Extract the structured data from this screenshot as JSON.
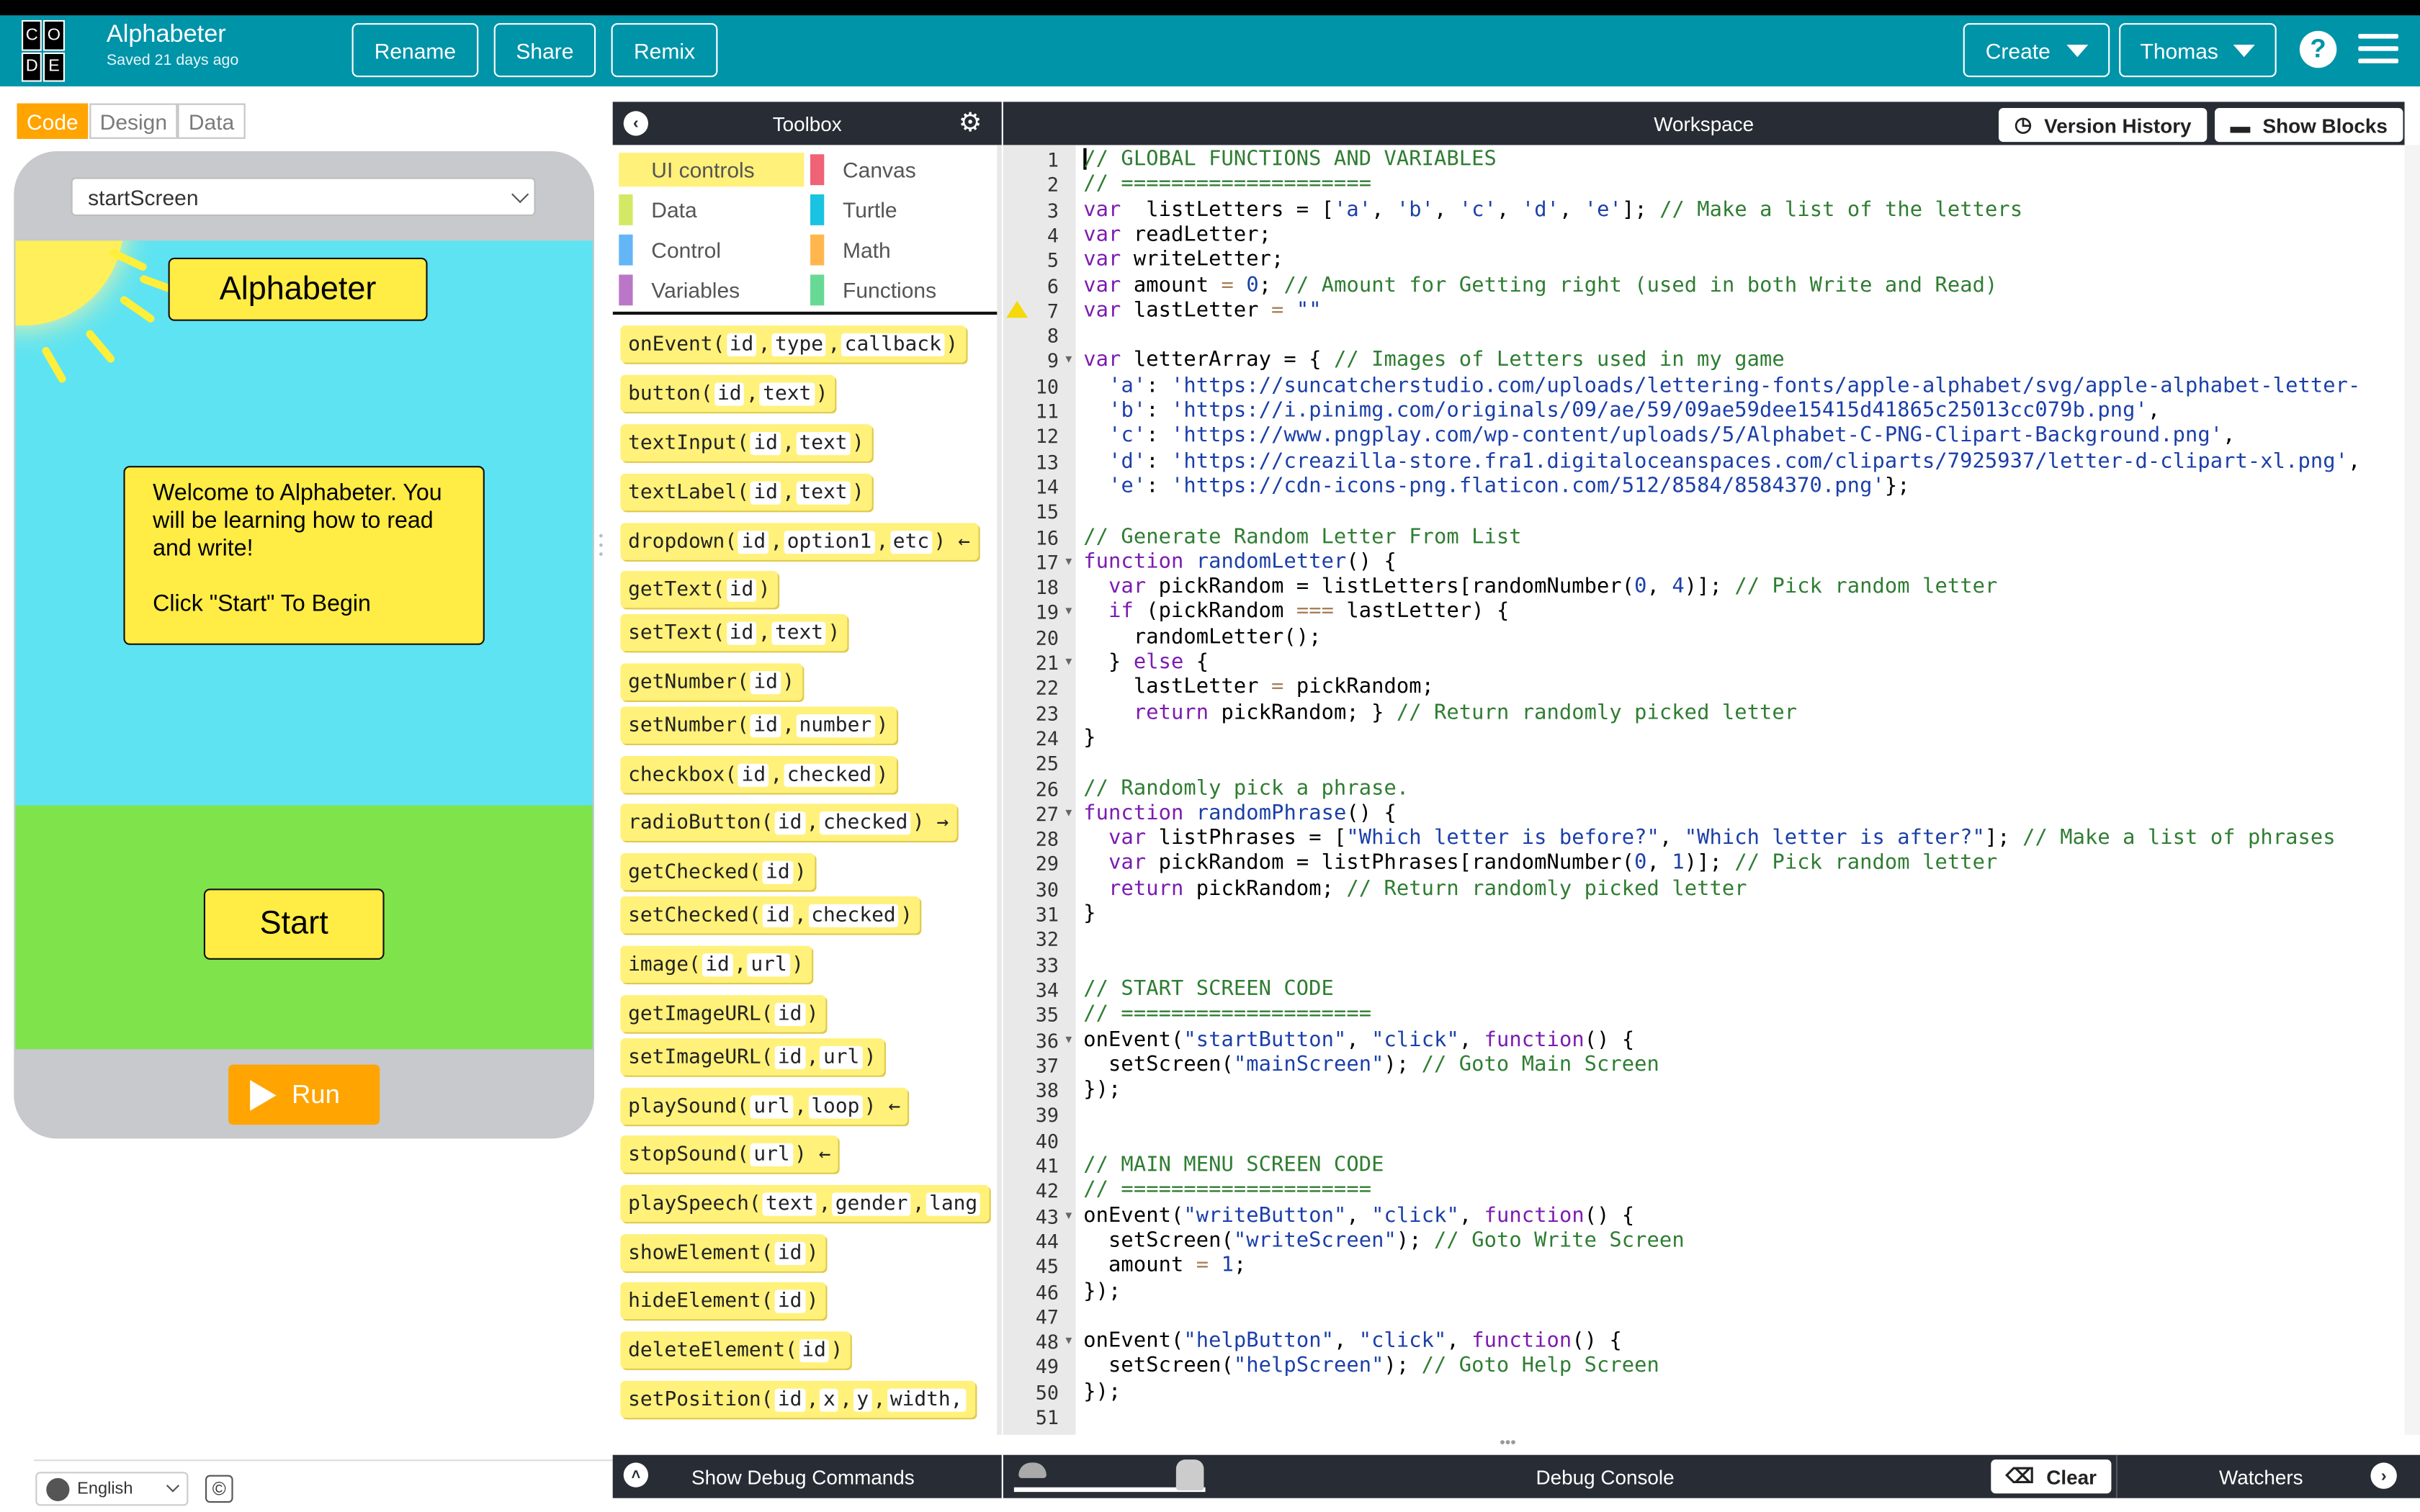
{
  "app": {
    "name": "Alphabeter",
    "saved": "Saved 21 days ago",
    "logo_letters": [
      "C",
      "O",
      "",
      "D",
      "E",
      ""
    ]
  },
  "header": {
    "rename": "Rename",
    "share": "Share",
    "remix": "Remix",
    "create": "Create",
    "user": "Thomas",
    "help": "?"
  },
  "left_tabs": {
    "code": "Code",
    "design": "Design",
    "data": "Data"
  },
  "preview": {
    "screen_select": "startScreen",
    "title": "Alphabeter",
    "welcome_line1": "Welcome to Alphabeter. You will be learning how to read and write!",
    "welcome_line2": "Click \"Start\" To Begin",
    "start": "Start",
    "run": "Run"
  },
  "footer": {
    "language": "English",
    "copyright": "©"
  },
  "toolbox": {
    "title": "Toolbox",
    "categories": [
      {
        "label": "UI controls",
        "color": "#fff17a"
      },
      {
        "label": "Canvas",
        "color": "#f06276"
      },
      {
        "label": "Data",
        "color": "#d3e965"
      },
      {
        "label": "Turtle",
        "color": "#19c3e1"
      },
      {
        "label": "Control",
        "color": "#64b5f6"
      },
      {
        "label": "Math",
        "color": "#ffb74d"
      },
      {
        "label": "Variables",
        "color": "#bb77c7"
      },
      {
        "label": "Functions",
        "color": "#68d995"
      }
    ],
    "blocks": [
      {
        "name": "onEvent",
        "params": [
          "id",
          "type",
          "callback"
        ],
        "tail": ")"
      },
      {
        "name": "button",
        "params": [
          "id",
          "text"
        ],
        "tail": ")"
      },
      {
        "name": "textInput",
        "params": [
          "id",
          "text"
        ],
        "tail": ")"
      },
      {
        "name": "textLabel",
        "params": [
          "id",
          "text"
        ],
        "tail": ")"
      },
      {
        "name": "dropdown",
        "params": [
          "id",
          "option1",
          "etc"
        ],
        "tail": ") ←"
      },
      {
        "name": "getText",
        "params": [
          "id"
        ],
        "tail": ")"
      },
      {
        "name": "setText",
        "params": [
          "id",
          "text"
        ],
        "tail": ")"
      },
      {
        "name": "getNumber",
        "params": [
          "id"
        ],
        "tail": ")"
      },
      {
        "name": "setNumber",
        "params": [
          "id",
          "number"
        ],
        "tail": ")"
      },
      {
        "name": "checkbox",
        "params": [
          "id",
          "checked"
        ],
        "tail": ")"
      },
      {
        "name": "radioButton",
        "params": [
          "id",
          "checked"
        ],
        "tail": ") →"
      },
      {
        "name": "getChecked",
        "params": [
          "id"
        ],
        "tail": ")"
      },
      {
        "name": "setChecked",
        "params": [
          "id",
          "checked"
        ],
        "tail": ")"
      },
      {
        "name": "image",
        "params": [
          "id",
          "url"
        ],
        "tail": ")"
      },
      {
        "name": "getImageURL",
        "params": [
          "id"
        ],
        "tail": ")"
      },
      {
        "name": "setImageURL",
        "params": [
          "id",
          "url"
        ],
        "tail": ")"
      },
      {
        "name": "playSound",
        "params": [
          "url",
          "loop"
        ],
        "tail": ") ←"
      },
      {
        "name": "stopSound",
        "params": [
          "url"
        ],
        "tail": ") ←"
      },
      {
        "name": "playSpeech",
        "params": [
          "text",
          "gender",
          "lang"
        ],
        "tail": ""
      },
      {
        "name": "showElement",
        "params": [
          "id"
        ],
        "tail": ")"
      },
      {
        "name": "hideElement",
        "params": [
          "id"
        ],
        "tail": ")"
      },
      {
        "name": "deleteElement",
        "params": [
          "id"
        ],
        "tail": ")"
      },
      {
        "name": "setPosition",
        "params": [
          "id",
          "x",
          "y",
          "width,"
        ],
        "tail": ""
      }
    ]
  },
  "workspace": {
    "title": "Workspace",
    "version_history": "Version History",
    "show_blocks": "Show Blocks",
    "fold_lines": [
      9,
      17,
      19,
      21,
      27,
      36,
      43,
      48
    ],
    "code": [
      [
        [
          "cm",
          "// GLOBAL FUNCTIONS AND VARIABLES"
        ]
      ],
      [
        [
          "cm",
          "// ===================="
        ]
      ],
      [
        [
          "kw",
          "var"
        ],
        [
          "",
          "  listLetters = ["
        ],
        [
          "st",
          "'a'"
        ],
        [
          "",
          ", "
        ],
        [
          "st",
          "'b'"
        ],
        [
          "",
          ", "
        ],
        [
          "st",
          "'c'"
        ],
        [
          "",
          ", "
        ],
        [
          "st",
          "'d'"
        ],
        [
          "",
          ", "
        ],
        [
          "st",
          "'e'"
        ],
        [
          "",
          "]; "
        ],
        [
          "cm",
          "// Make a list of the letters"
        ]
      ],
      [
        [
          "kw",
          "var"
        ],
        [
          "",
          " readLetter;"
        ]
      ],
      [
        [
          "kw",
          "var"
        ],
        [
          "",
          " writeLetter;"
        ]
      ],
      [
        [
          "kw",
          "var"
        ],
        [
          "",
          " amount "
        ],
        [
          "op",
          "="
        ],
        [
          "",
          " "
        ],
        [
          "nu",
          "0"
        ],
        [
          "",
          ";"
        ],
        [
          "cm",
          " // Amount for Getting right (used in both Write and Read)"
        ]
      ],
      [
        [
          "kw",
          "var"
        ],
        [
          "",
          " lastLetter "
        ],
        [
          "op",
          "="
        ],
        [
          "",
          " "
        ],
        [
          "st",
          "\"\""
        ]
      ],
      [
        [
          "",
          ""
        ]
      ],
      [
        [
          "kw",
          "var"
        ],
        [
          "",
          " letterArray = { "
        ],
        [
          "cm",
          "// Images of Letters used in my game"
        ]
      ],
      [
        [
          "",
          "  "
        ],
        [
          "st",
          "'a'"
        ],
        [
          "",
          ": "
        ],
        [
          "st",
          "'https://suncatcherstudio.com/uploads/lettering-fonts/apple-alphabet/svg/apple-alphabet-letter-"
        ]
      ],
      [
        [
          "",
          "  "
        ],
        [
          "st",
          "'b'"
        ],
        [
          "",
          ": "
        ],
        [
          "st",
          "'https://i.pinimg.com/originals/09/ae/59/09ae59dee15415d41865c25013cc079b.png'"
        ],
        [
          "",
          ","
        ]
      ],
      [
        [
          "",
          "  "
        ],
        [
          "st",
          "'c'"
        ],
        [
          "",
          ": "
        ],
        [
          "st",
          "'https://www.pngplay.com/wp-content/uploads/5/Alphabet-C-PNG-Clipart-Background.png'"
        ],
        [
          "",
          ","
        ]
      ],
      [
        [
          "",
          "  "
        ],
        [
          "st",
          "'d'"
        ],
        [
          "",
          ": "
        ],
        [
          "st",
          "'https://creazilla-store.fra1.digitaloceanspaces.com/cliparts/7925937/letter-d-clipart-xl.png'"
        ],
        [
          "",
          ","
        ]
      ],
      [
        [
          "",
          "  "
        ],
        [
          "st",
          "'e'"
        ],
        [
          "",
          ": "
        ],
        [
          "st",
          "'https://cdn-icons-png.flaticon.com/512/8584/8584370.png'"
        ],
        [
          "",
          "};"
        ]
      ],
      [
        [
          "",
          ""
        ]
      ],
      [
        [
          "cm",
          "// Generate Random Letter From List"
        ]
      ],
      [
        [
          "kw",
          "function"
        ],
        [
          "",
          " "
        ],
        [
          "fn",
          "randomLetter"
        ],
        [
          "",
          "() {"
        ]
      ],
      [
        [
          "",
          "  "
        ],
        [
          "kw",
          "var"
        ],
        [
          "",
          " pickRandom = listLetters[randomNumber("
        ],
        [
          "nu",
          "0"
        ],
        [
          "",
          ", "
        ],
        [
          "nu",
          "4"
        ],
        [
          "",
          ")]; "
        ],
        [
          "cm",
          "// Pick random letter"
        ]
      ],
      [
        [
          "",
          "  "
        ],
        [
          "kw",
          "if"
        ],
        [
          "",
          " (pickRandom "
        ],
        [
          "op",
          "==="
        ],
        [
          "",
          " lastLetter) {"
        ]
      ],
      [
        [
          "",
          "    randomLetter();"
        ]
      ],
      [
        [
          "",
          "  } "
        ],
        [
          "kw",
          "else"
        ],
        [
          "",
          " {"
        ]
      ],
      [
        [
          "",
          "    lastLetter "
        ],
        [
          "op",
          "="
        ],
        [
          "",
          " pickRandom;"
        ]
      ],
      [
        [
          "",
          "    "
        ],
        [
          "kw",
          "return"
        ],
        [
          "",
          " pickRandom; } "
        ],
        [
          "cm",
          "// Return randomly picked letter"
        ]
      ],
      [
        [
          "",
          "}"
        ]
      ],
      [
        [
          "",
          ""
        ]
      ],
      [
        [
          "cm",
          "// Randomly pick a phrase."
        ]
      ],
      [
        [
          "kw",
          "function"
        ],
        [
          "",
          " "
        ],
        [
          "fn",
          "randomPhrase"
        ],
        [
          "",
          "() {"
        ]
      ],
      [
        [
          "",
          "  "
        ],
        [
          "kw",
          "var"
        ],
        [
          "",
          " listPhrases = ["
        ],
        [
          "st",
          "\"Which letter is before?\""
        ],
        [
          "",
          ", "
        ],
        [
          "st",
          "\"Which letter is after?\""
        ],
        [
          "",
          "]; "
        ],
        [
          "cm",
          "// Make a list of phrases"
        ]
      ],
      [
        [
          "",
          "  "
        ],
        [
          "kw",
          "var"
        ],
        [
          "",
          " pickRandom = listPhrases[randomNumber("
        ],
        [
          "nu",
          "0"
        ],
        [
          "",
          ", "
        ],
        [
          "nu",
          "1"
        ],
        [
          "",
          ")]; "
        ],
        [
          "cm",
          "// Pick random letter"
        ]
      ],
      [
        [
          "",
          "  "
        ],
        [
          "kw",
          "return"
        ],
        [
          "",
          " pickRandom; "
        ],
        [
          "cm",
          "// Return randomly picked letter"
        ]
      ],
      [
        [
          "",
          "}"
        ]
      ],
      [
        [
          "",
          ""
        ]
      ],
      [
        [
          "",
          ""
        ]
      ],
      [
        [
          "cm",
          "// START SCREEN CODE"
        ]
      ],
      [
        [
          "cm",
          "// ===================="
        ]
      ],
      [
        [
          "",
          "onEvent("
        ],
        [
          "st",
          "\"startButton\""
        ],
        [
          "",
          ", "
        ],
        [
          "st",
          "\"click\""
        ],
        [
          "",
          ", "
        ],
        [
          "kw",
          "function"
        ],
        [
          "",
          "() {"
        ]
      ],
      [
        [
          "",
          "  setScreen("
        ],
        [
          "st",
          "\"mainScreen\""
        ],
        [
          "",
          "); "
        ],
        [
          "cm",
          "// Goto Main Screen"
        ]
      ],
      [
        [
          "",
          "});"
        ]
      ],
      [
        [
          "",
          ""
        ]
      ],
      [
        [
          "",
          ""
        ]
      ],
      [
        [
          "cm",
          "// MAIN MENU SCREEN CODE"
        ]
      ],
      [
        [
          "cm",
          "// ===================="
        ]
      ],
      [
        [
          "",
          "onEvent("
        ],
        [
          "st",
          "\"writeButton\""
        ],
        [
          "",
          ", "
        ],
        [
          "st",
          "\"click\""
        ],
        [
          "",
          ", "
        ],
        [
          "kw",
          "function"
        ],
        [
          "",
          "() {"
        ]
      ],
      [
        [
          "",
          "  setScreen("
        ],
        [
          "st",
          "\"writeScreen\""
        ],
        [
          "",
          "); "
        ],
        [
          "cm",
          "// Goto Write Screen"
        ]
      ],
      [
        [
          "",
          "  amount "
        ],
        [
          "op",
          "="
        ],
        [
          "",
          " "
        ],
        [
          "nu",
          "1"
        ],
        [
          "",
          ";"
        ]
      ],
      [
        [
          "",
          "});"
        ]
      ],
      [
        [
          "",
          ""
        ]
      ],
      [
        [
          "",
          "onEvent("
        ],
        [
          "st",
          "\"helpButton\""
        ],
        [
          "",
          ", "
        ],
        [
          "st",
          "\"click\""
        ],
        [
          "",
          ", "
        ],
        [
          "kw",
          "function"
        ],
        [
          "",
          "() {"
        ]
      ],
      [
        [
          "",
          "  setScreen("
        ],
        [
          "st",
          "\"helpScreen\""
        ],
        [
          "",
          "); "
        ],
        [
          "cm",
          "// Goto Help Screen"
        ]
      ],
      [
        [
          "",
          "});"
        ]
      ],
      [
        [
          "",
          ""
        ]
      ]
    ]
  },
  "bottom": {
    "show_debug": "Show Debug Commands",
    "debug_console": "Debug Console",
    "clear": "Clear",
    "watchers": "Watchers"
  }
}
